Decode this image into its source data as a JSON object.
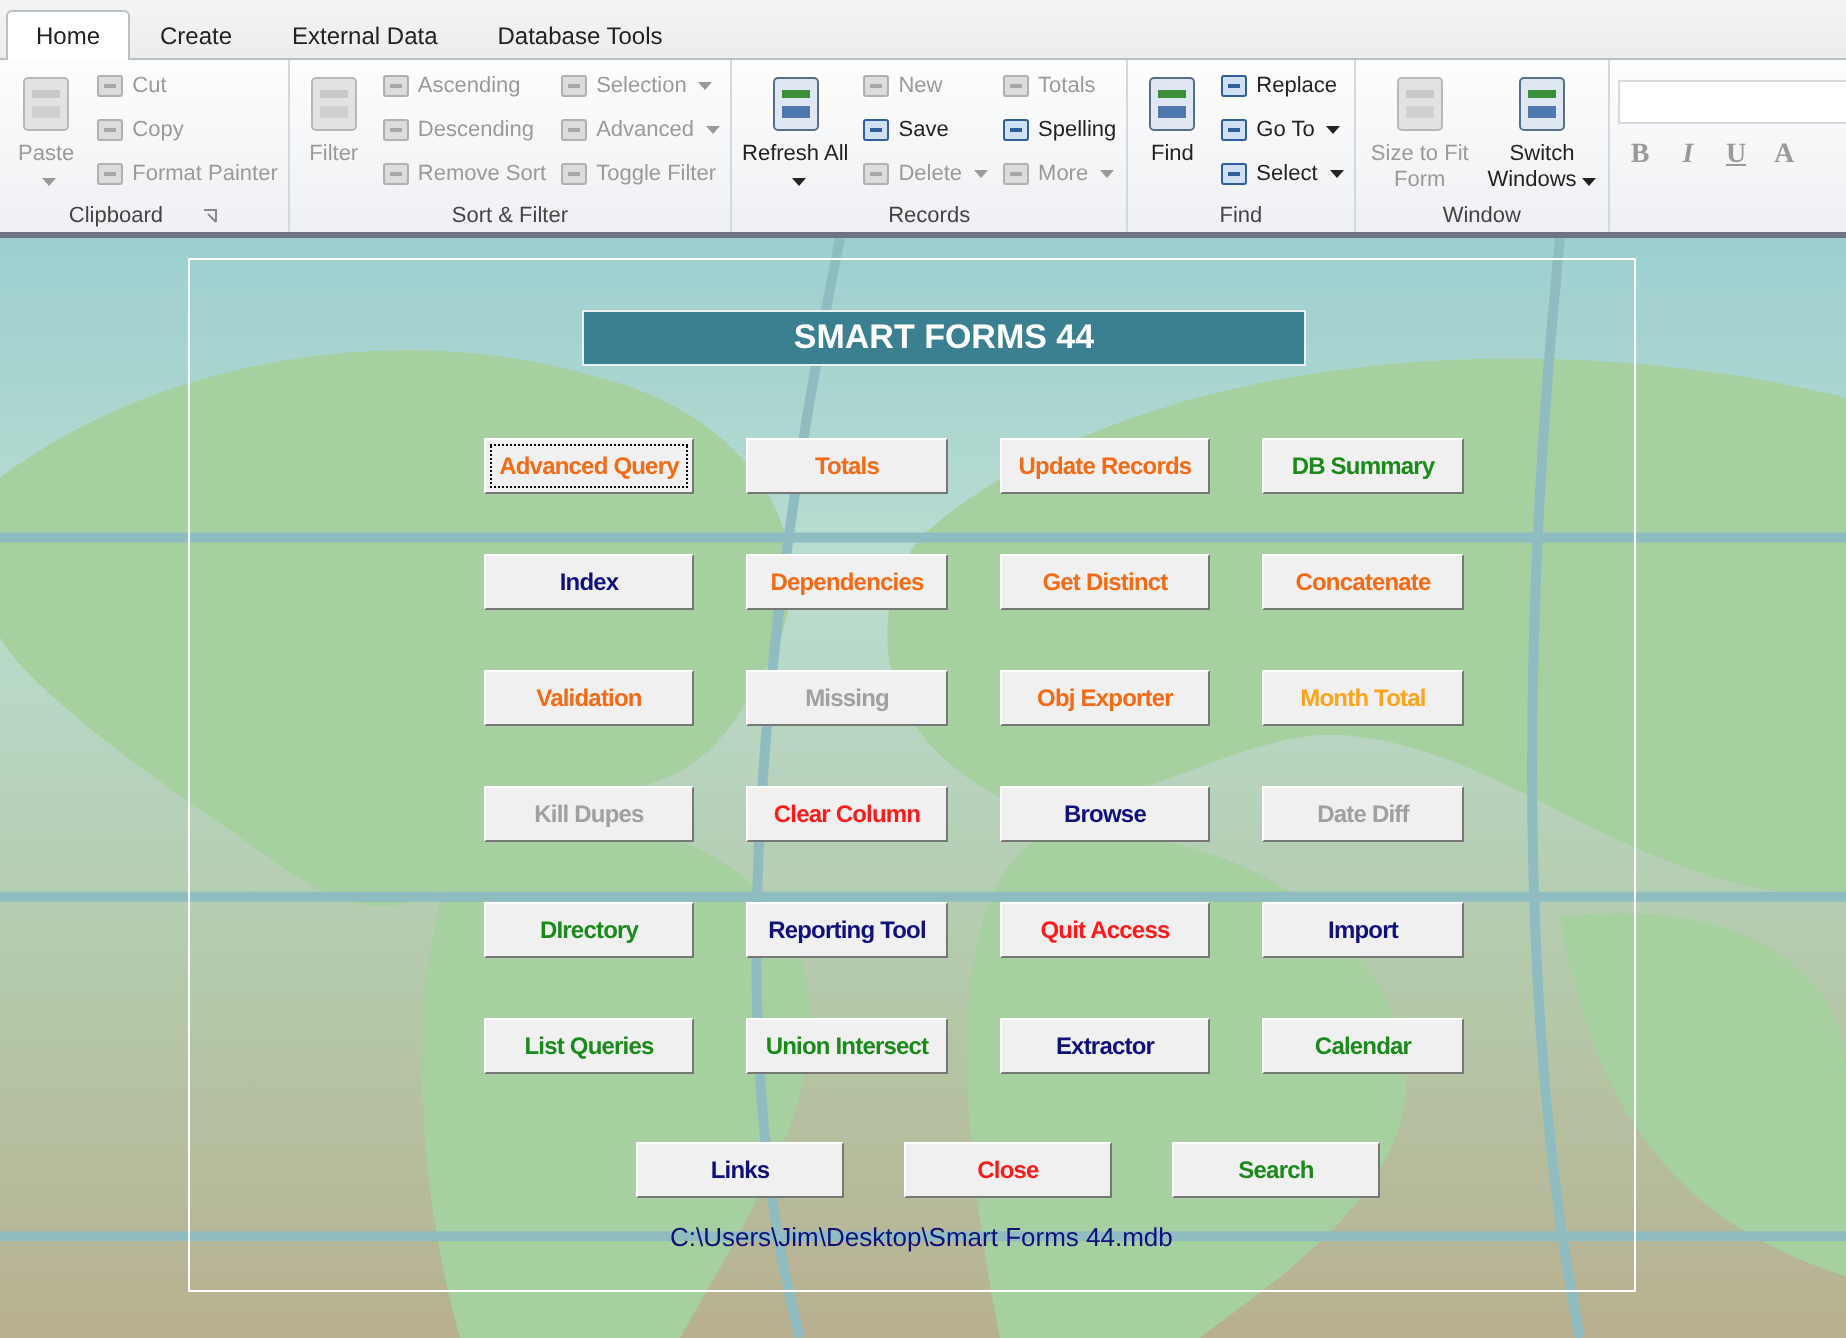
{
  "ribbon": {
    "tabs": [
      {
        "label": "Home",
        "selected": true
      },
      {
        "label": "Create",
        "selected": false
      },
      {
        "label": "External Data",
        "selected": false
      },
      {
        "label": "Database Tools",
        "selected": false
      }
    ],
    "groups": [
      {
        "title": "Clipboard",
        "launcher": true,
        "large": [
          {
            "label": "Paste",
            "disabled": true,
            "dropdown": true
          }
        ],
        "small": [
          [
            {
              "label": "Cut",
              "disabled": true,
              "dropdown": false
            },
            {
              "label": "Copy",
              "disabled": true,
              "dropdown": false
            },
            {
              "label": "Format Painter",
              "disabled": true,
              "dropdown": false
            }
          ]
        ]
      },
      {
        "title": "Sort & Filter",
        "large": [
          {
            "label": "Filter",
            "disabled": true,
            "dropdown": false
          }
        ],
        "small": [
          [
            {
              "label": "Ascending",
              "disabled": true,
              "dropdown": false
            },
            {
              "label": "Descending",
              "disabled": true,
              "dropdown": false
            },
            {
              "label": "Remove Sort",
              "disabled": true,
              "dropdown": false
            }
          ],
          [
            {
              "label": "Selection",
              "disabled": true,
              "dropdown": true
            },
            {
              "label": "Advanced",
              "disabled": true,
              "dropdown": true
            },
            {
              "label": "Toggle Filter",
              "disabled": true,
              "dropdown": false
            }
          ]
        ]
      },
      {
        "title": "Records",
        "large": [
          {
            "label": "Refresh All",
            "disabled": false,
            "dropdown": true
          }
        ],
        "small": [
          [
            {
              "label": "New",
              "disabled": true,
              "dropdown": false
            },
            {
              "label": "Save",
              "disabled": false,
              "dropdown": false
            },
            {
              "label": "Delete",
              "disabled": true,
              "dropdown": true
            }
          ],
          [
            {
              "label": "Totals",
              "disabled": true,
              "dropdown": false
            },
            {
              "label": "Spelling",
              "disabled": false,
              "dropdown": false
            },
            {
              "label": "More",
              "disabled": true,
              "dropdown": true
            }
          ]
        ]
      },
      {
        "title": "Find",
        "large": [
          {
            "label": "Find",
            "disabled": false,
            "dropdown": false
          }
        ],
        "small": [
          [
            {
              "label": "Replace",
              "disabled": false,
              "dropdown": false
            },
            {
              "label": "Go To",
              "disabled": false,
              "dropdown": true
            },
            {
              "label": "Select",
              "disabled": false,
              "dropdown": true
            }
          ]
        ]
      },
      {
        "title": "Window",
        "large": [
          {
            "label": "Size to Fit Form",
            "disabled": true,
            "dropdown": false
          },
          {
            "label": "Switch Windows",
            "disabled": false,
            "dropdown": true
          }
        ]
      }
    ],
    "format_buttons": [
      {
        "label": "B",
        "disabled": true
      },
      {
        "label": "I",
        "disabled": true
      },
      {
        "label": "U",
        "disabled": true
      },
      {
        "label": "A",
        "disabled": true
      }
    ]
  },
  "form": {
    "title": "SMART FORMS 44",
    "button_rows": [
      [
        {
          "label": "Advanced Query",
          "color": "#f56a14",
          "focused": true
        },
        {
          "label": "Totals",
          "color": "#f56a14",
          "focused": false
        },
        {
          "label": "Update Records",
          "color": "#f56a14",
          "focused": false
        },
        {
          "label": "DB Summary",
          "color": "#1a8a1a",
          "focused": false
        }
      ],
      [
        {
          "label": "Index",
          "color": "#10107a",
          "focused": false
        },
        {
          "label": "Dependencies",
          "color": "#f56a14",
          "focused": false
        },
        {
          "label": "Get Distinct",
          "color": "#f56a14",
          "focused": false
        },
        {
          "label": "Concatenate",
          "color": "#f56a14",
          "focused": false
        }
      ],
      [
        {
          "label": "Validation",
          "color": "#f56a14",
          "focused": false
        },
        {
          "label": "Missing",
          "color": "#a0a0a0",
          "focused": false
        },
        {
          "label": "Obj Exporter",
          "color": "#f56a14",
          "focused": false
        },
        {
          "label": "Month Total",
          "color": "#ffa31a",
          "focused": false
        }
      ],
      [
        {
          "label": "Kill Dupes",
          "color": "#a0a0a0",
          "focused": false
        },
        {
          "label": "Clear Column",
          "color": "#ff1a1a",
          "focused": false
        },
        {
          "label": "Browse",
          "color": "#10107a",
          "focused": false
        },
        {
          "label": "Date Diff",
          "color": "#a0a0a0",
          "focused": false
        }
      ],
      [
        {
          "label": "DIrectory",
          "color": "#1a8a1a",
          "focused": false
        },
        {
          "label": "Reporting Tool",
          "color": "#10107a",
          "focused": false
        },
        {
          "label": "Quit Access",
          "color": "#ff1a1a",
          "focused": false
        },
        {
          "label": "Import",
          "color": "#10107a",
          "focused": false
        }
      ],
      [
        {
          "label": "List Queries",
          "color": "#1a8a1a",
          "focused": false
        },
        {
          "label": "Union Intersect",
          "color": "#1a8a1a",
          "focused": false
        },
        {
          "label": "Extractor",
          "color": "#10107a",
          "focused": false
        },
        {
          "label": "Calendar",
          "color": "#1a8a1a",
          "focused": false
        }
      ]
    ],
    "bottom_buttons": [
      {
        "label": "Links",
        "color": "#10107a",
        "focused": false
      },
      {
        "label": "Close",
        "color": "#ff1a1a",
        "focused": false
      },
      {
        "label": "Search",
        "color": "#1a8a1a",
        "focused": false
      }
    ],
    "path": "C:\\Users\\Jim\\Desktop\\Smart Forms 44.mdb"
  }
}
